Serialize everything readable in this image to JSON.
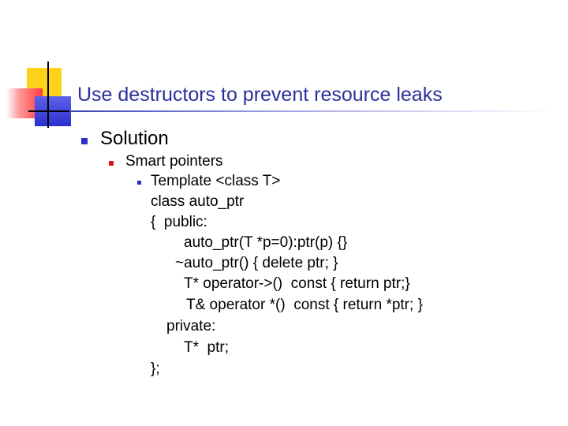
{
  "slide": {
    "title": "Use destructors to prevent resource leaks",
    "level1": {
      "text": "Solution"
    },
    "level2": {
      "text": "Smart pointers"
    },
    "level3": {
      "text": "Template <class T>"
    },
    "code_lines": [
      "class auto_ptr",
      "{  public:",
      "auto_ptr(T *p=0):ptr(p) {}",
      "~auto_ptr() { delete ptr; }",
      "T* operator->()  const { return ptr;}",
      "T& operator *()  const { return *ptr; }",
      "private:",
      "T*  ptr;",
      "};"
    ]
  },
  "theme": {
    "title_color": "#2b2f9b",
    "bullet_blue": "#2b2fc4",
    "bullet_red": "#e01010",
    "logo_yellow": "#ffd21a",
    "logo_red": "#ff3b3b",
    "logo_blue": "#2a2fd0"
  }
}
